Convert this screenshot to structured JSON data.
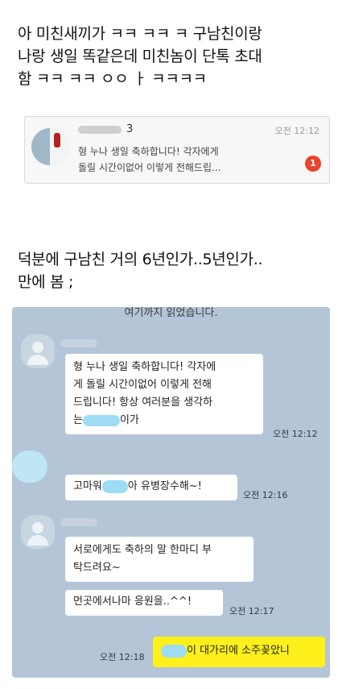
{
  "caption1": [
    "아 미친새끼가 ㅋㅋ ㅋㅋ ㅋ 구남친이랑",
    "나랑 생일 똑같은데 미친놈이 단톡 초대",
    "함 ㅋㅋ ㅋㅋ ㅇㅇ ㅏ ㅋㅋㅋㅋ"
  ],
  "notification": {
    "sender_suffix": "3",
    "time": "오전 12:12",
    "line1": "형 누나 생일 축하합니다! 각자에게",
    "line2": "돌릴 시간이없어 이렇게 전해드립...",
    "badge": "1"
  },
  "caption2": [
    "덕분에 구남친 거의 6년인가..5년인가..",
    "만에 봄 ;"
  ],
  "chat": {
    "notice": "여기까지 읽었습니다.",
    "msg1_lines": [
      "형 누나 생일 축하합니다! 각자에",
      "게 돌릴 시간이없어 이렇게 전해",
      "드립니다! 항상 여러분을 생각하",
      "는"
    ],
    "msg1_tail": "이가",
    "msg1_time": "오전 12:12",
    "msg2_pre": "고마워",
    "msg2_post": "아 유병장수해~!",
    "msg2_time": "오전 12:16",
    "msg3_lines": [
      "서로에게도 축하의 말 한마디 부",
      "탁드려요~"
    ],
    "msg4": "먼곳에서나마 응원을..^^!",
    "msg4_time": "오전 12:17",
    "msg5": "이 대가리에 소주꽂았니",
    "msg5_time": "오전 12:18"
  }
}
